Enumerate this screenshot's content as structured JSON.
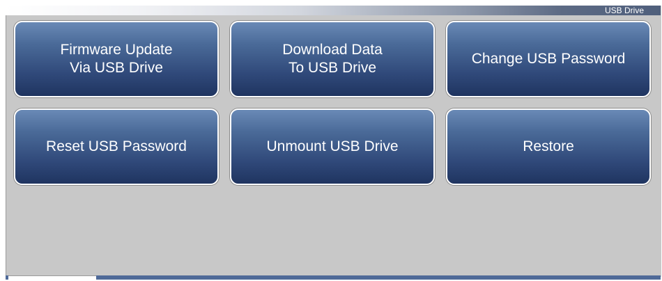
{
  "header": {
    "title": "USB Drive"
  },
  "buttons": {
    "firmware_update": [
      "Firmware Update",
      "Via USB Drive"
    ],
    "download_data": [
      "Download Data",
      "To USB Drive"
    ],
    "change_password": "Change USB Password",
    "reset_password": "Reset USB Password",
    "unmount": "Unmount USB Drive",
    "restore": "Restore"
  },
  "colors": {
    "button_top": "#6a8ab6",
    "button_bottom": "#1f3460",
    "panel_background": "#c8c8c8"
  }
}
